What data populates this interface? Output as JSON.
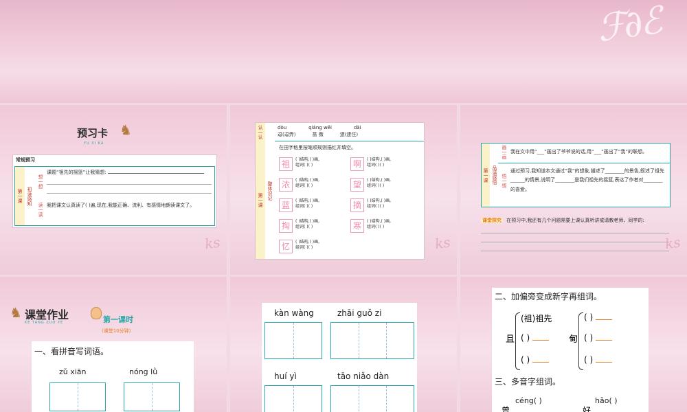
{
  "banner": {
    "signature": "Ks"
  },
  "tile1": {
    "logo": "预习卡",
    "logo_sub": "YU XI KA",
    "section": "常规预习",
    "side_label": "第一课",
    "rows": [
      {
        "label": "想一想",
        "mid": "初读感知",
        "text": "课题“祖先的摇篮”让我猜想:"
      },
      {
        "label": "读一读",
        "mid": "",
        "text": "我把课文认真读了(      )遍,现在,我能正确、流利、有感情地朗读课文了。"
      }
    ]
  },
  "tile2": {
    "side_a": "认一认",
    "side_b": "写一写",
    "side_c": "第一课",
    "side_d": "整体识记",
    "pinyin_row": [
      "dòu",
      "qiáng wēi",
      "dài"
    ],
    "word_row": [
      "逗(逗弄)",
      "蔷  薇",
      "逮(逮住)"
    ],
    "instruction": "在田字格里按笔顺规则描红并填空。",
    "left_chars": [
      "祖",
      "浓",
      "蓝",
      "掏",
      "忆"
    ],
    "right_chars": [
      "啊",
      "望",
      "摘",
      "寒"
    ],
    "struct": "(   )结构,(  )画,",
    "group": "组词(    )(    )"
  },
  "tile3": {
    "side": "第一课",
    "col_a": "画一画",
    "col_b": "品读感悟",
    "col_c": "悟一悟",
    "line1": "我在文中用“___”画出了爷爷说的话,用“___”画出了“我”的联想。",
    "line2": "通过预习,我知道本文通过“我”的想象,描述了________的景色,叙述了祖先______的情景,说明了________是我们祖先的摇篮,表达了作者对________的喜爱。",
    "tag": "课堂探究",
    "question": "在预习中,我还有几个问题需要上课认真听讲或请教老师、同学的:"
  },
  "tile4": {
    "logo": "课堂作业",
    "logo_sub": "KE TANG ZUO YE",
    "lesson": "第一课时",
    "time": "(课堂10分钟)",
    "heading": "一、看拼音写词语。",
    "words": [
      {
        "py": "zǔ   xiān"
      },
      {
        "py": "nóng   lǜ"
      }
    ]
  },
  "tile5": {
    "row1": [
      "kàn  wàng",
      "zhāi  guǒ  zi"
    ],
    "row2": [
      "huí  yì",
      "tāo  niǎo  dàn"
    ]
  },
  "tile6": {
    "heading1": "二、加偏旁变成新字再组词。",
    "base1": "且",
    "base2": "甸",
    "first_item": "(祖)祖先",
    "blank": "(   )",
    "heading2": "三、多音字组词。",
    "poly1_char": "曾",
    "poly1_py": "céng(        )",
    "poly2_char": "好",
    "poly2_py": "hǎo(        )"
  }
}
